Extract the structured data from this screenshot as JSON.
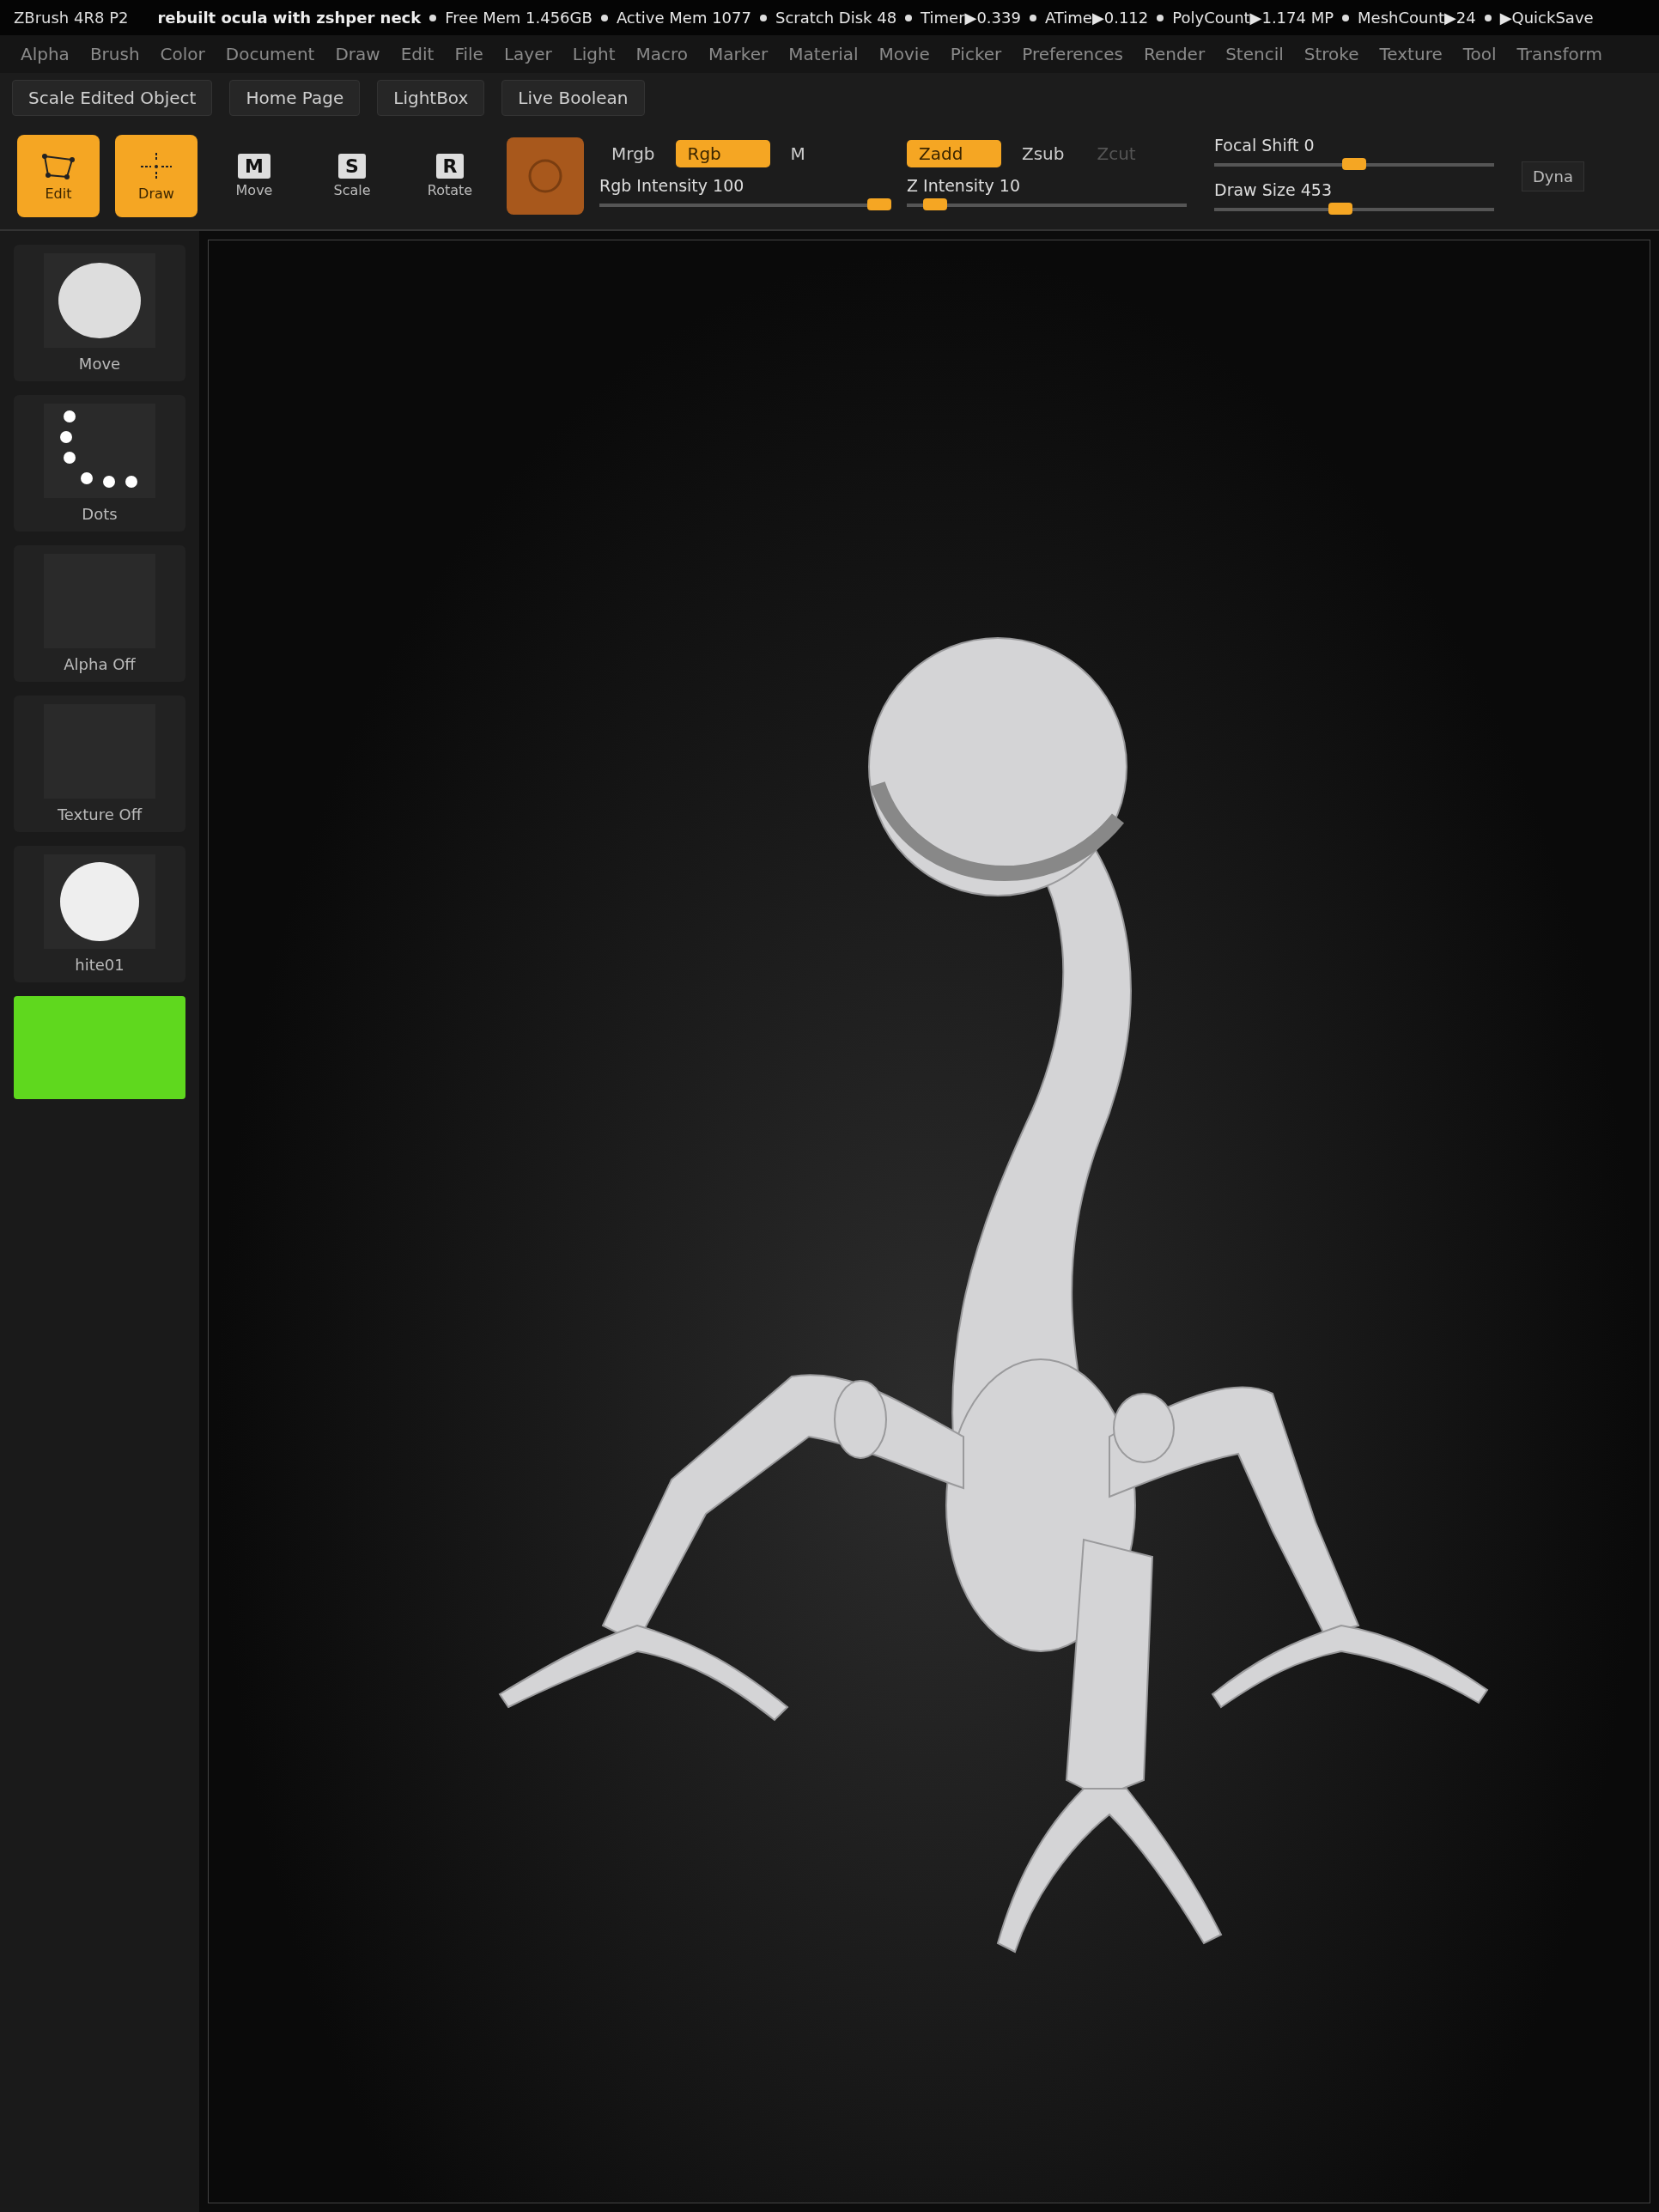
{
  "window": {
    "app": "ZBrush 4R8 P2",
    "document": "rebuilt ocula with zshper neck"
  },
  "status": [
    "Free Mem 1.456GB",
    "Active Mem 1077",
    "Scratch Disk 48",
    "Timer▶0.339",
    "ATime▶0.112",
    "PolyCount▶1.174 MP",
    "MeshCount▶24",
    "▶QuickSave"
  ],
  "menu": [
    "Alpha",
    "Brush",
    "Color",
    "Document",
    "Draw",
    "Edit",
    "File",
    "Layer",
    "Light",
    "Macro",
    "Marker",
    "Material",
    "Movie",
    "Picker",
    "Preferences",
    "Render",
    "Stencil",
    "Stroke",
    "Texture",
    "Tool",
    "Transform"
  ],
  "shelf_buttons": [
    "Scale Edited Object",
    "Home Page",
    "LightBox",
    "Live Boolean"
  ],
  "tools": [
    {
      "kind": "edit",
      "label": "Edit",
      "selected": true
    },
    {
      "kind": "draw",
      "label": "Draw",
      "selected": true
    },
    {
      "kind": "move",
      "label": "Move",
      "letter": "M",
      "selected": false
    },
    {
      "kind": "scale",
      "label": "Scale",
      "letter": "S",
      "selected": false
    },
    {
      "kind": "rotate",
      "label": "Rotate",
      "letter": "R",
      "selected": false
    }
  ],
  "color_modes": [
    {
      "label": "Mrgb",
      "selected": false
    },
    {
      "label": "Rgb",
      "selected": true
    },
    {
      "label": "M",
      "selected": false
    }
  ],
  "rgb_intensity": {
    "label": "Rgb Intensity 100",
    "level": 1
  },
  "z_modes": [
    {
      "label": "Zadd",
      "selected": true,
      "disabled": false
    },
    {
      "label": "Zsub",
      "selected": false,
      "disabled": false
    },
    {
      "label": "Zcut",
      "selected": false,
      "disabled": true
    }
  ],
  "z_intensity": {
    "label": "Z Intensity 10",
    "level": 0.1
  },
  "focal_shift": {
    "label": "Focal Shift 0",
    "level": 0.5
  },
  "draw_size": {
    "label": "Draw Size 453",
    "level": 0.45
  },
  "dynamic": "Dyna",
  "left_shelf": [
    {
      "kind": "brush",
      "label": "Move"
    },
    {
      "kind": "stroke",
      "label": "Dots"
    },
    {
      "kind": "empty",
      "label": "Alpha Off"
    },
    {
      "kind": "empty",
      "label": "Texture Off"
    },
    {
      "kind": "material",
      "label": "hite01"
    }
  ]
}
